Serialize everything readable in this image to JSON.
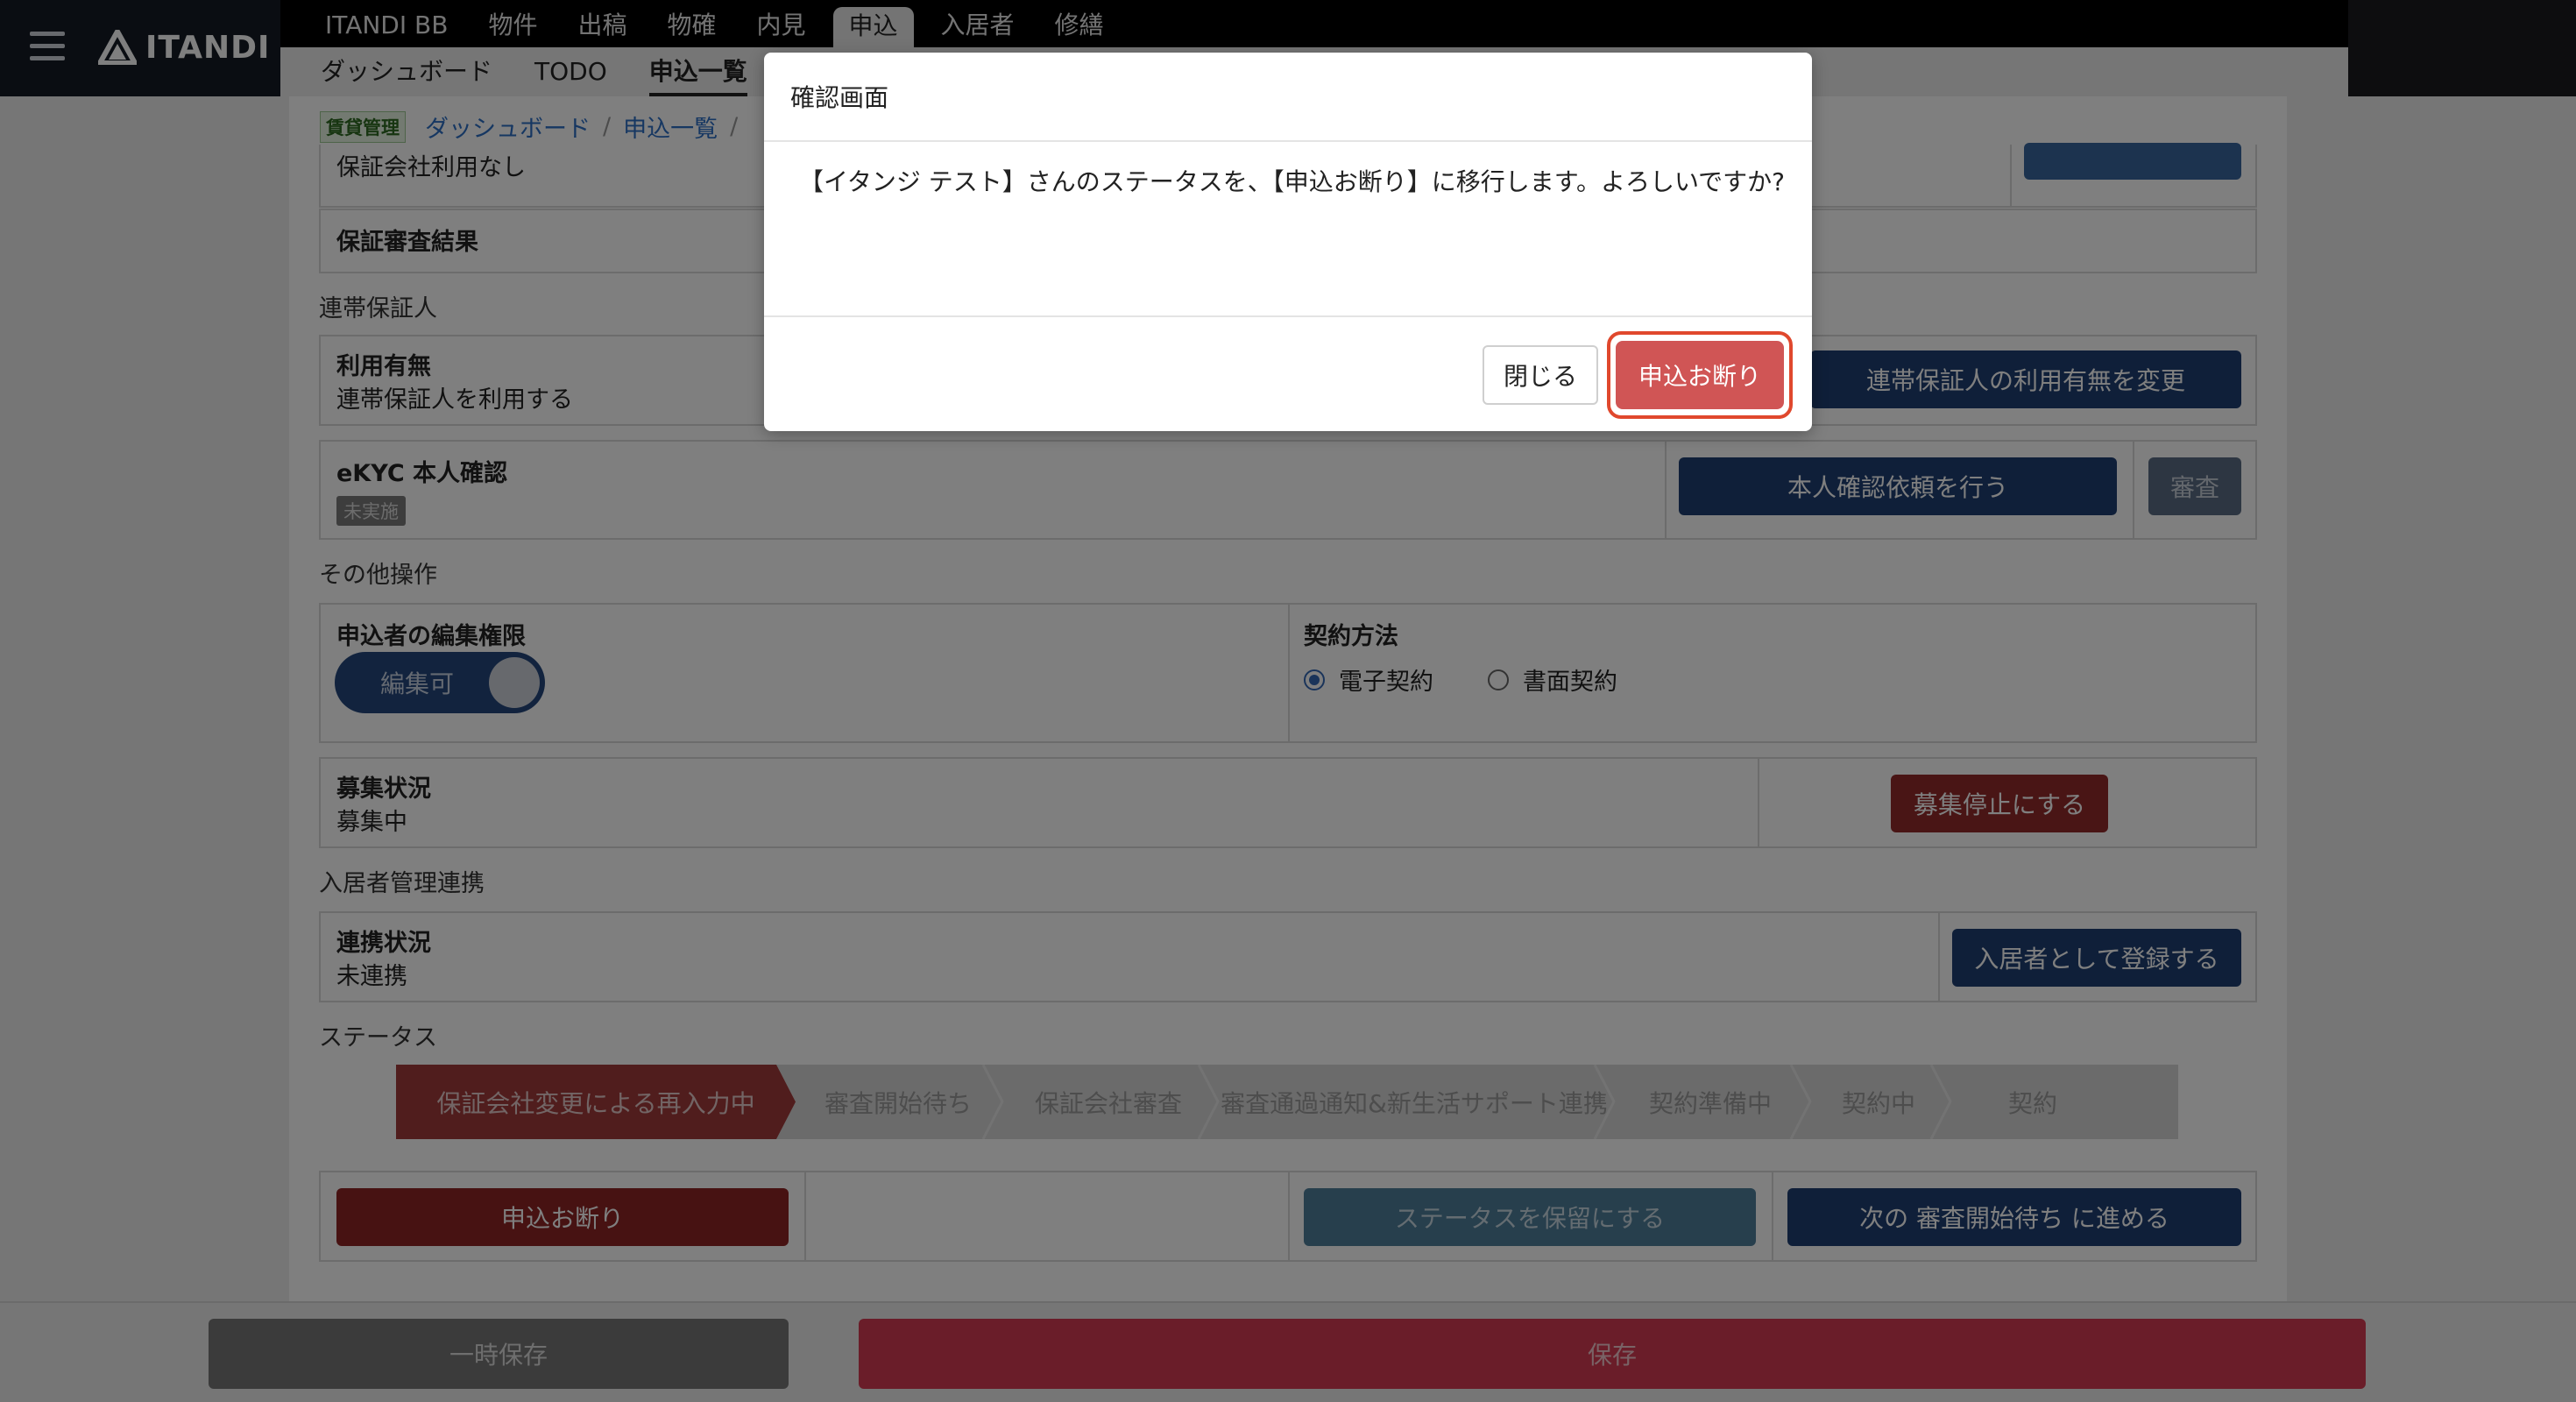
{
  "header": {
    "logo_text": "ITANDI",
    "primary_nav": [
      "ITANDI BB",
      "物件",
      "出稿",
      "物確",
      "内見",
      "申込",
      "入居者",
      "修繕"
    ],
    "primary_active": "申込",
    "secondary_nav": [
      "ダッシュボード",
      "TODO",
      "申込一覧"
    ],
    "secondary_active": "申込一覧"
  },
  "breadcrumb": {
    "tag": "賃貸管理",
    "items": [
      "ダッシュボード",
      "申込一覧"
    ]
  },
  "sections": {
    "guarantor_company": {
      "value": "保証会社利用なし",
      "review_result_label": "保証審査結果"
    },
    "joint_guarantor": {
      "title": "連帯保証人",
      "usage_label": "利用有無",
      "usage_value": "連帯保証人を利用する",
      "change_button": "連帯保証人の利用有無を変更"
    },
    "ekyc": {
      "label": "eKYC 本人確認",
      "status_badge": "未実施",
      "request_button": "本人確認依頼を行う",
      "review_button": "審査"
    },
    "other_ops": {
      "title": "その他操作",
      "edit_permission_label": "申込者の編集権限",
      "edit_toggle_text": "編集可",
      "contract_method_label": "契約方法",
      "contract_options": [
        "電子契約",
        "書面契約"
      ],
      "contract_selected": "電子契約"
    },
    "recruitment": {
      "label": "募集状況",
      "value": "募集中",
      "stop_button": "募集停止にする"
    },
    "resident_link": {
      "title": "入居者管理連携",
      "label": "連携状況",
      "value": "未連携",
      "register_button": "入居者として登録する"
    },
    "status": {
      "title": "ステータス",
      "steps": [
        "保証会社変更による再入力中",
        "審査開始待ち",
        "保証会社審査",
        "審査通過通知&新生活サポート連携",
        "契約準備中",
        "契約中",
        "契約"
      ],
      "current_step": "保証会社変更による再入力中"
    },
    "actions": {
      "decline_button": "申込お断り",
      "hold_button": "ステータスを保留にする",
      "next_button": "次の 審査開始待ち に進める"
    }
  },
  "footer": {
    "temp_save_button": "一時保存",
    "save_button": "保存"
  },
  "modal": {
    "title": "確認画面",
    "message": "【イタンジ テスト】さんのステータスを、【申込お断り】に移行します。よろしいですか?",
    "close_button": "閉じる",
    "confirm_button": "申込お断り"
  },
  "colors": {
    "confirm_button": "#d05555",
    "highlight_ring": "#e0482d",
    "primary_blue": "#1f3f72",
    "danger_red": "#922b2b"
  }
}
